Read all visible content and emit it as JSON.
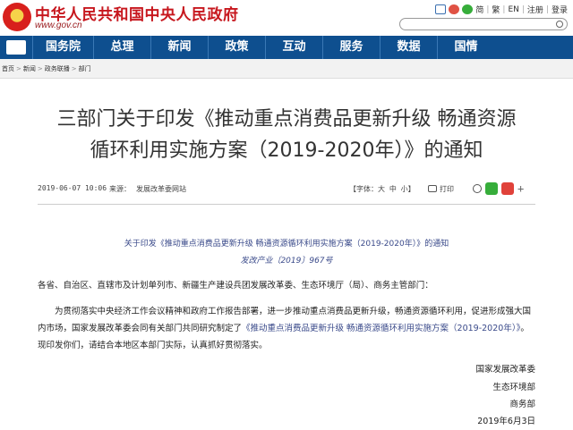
{
  "header": {
    "site_title": "中华人民共和国中央人民政府",
    "site_domain": "www.gov.cn",
    "links": [
      "简",
      "繁",
      "EN",
      "注册",
      "登录"
    ]
  },
  "nav": {
    "items": [
      "国务院",
      "总理",
      "新闻",
      "政策",
      "互动",
      "服务",
      "数据",
      "国情"
    ]
  },
  "breadcrumb": {
    "items": [
      "首页",
      "新闻",
      "政务联播",
      "部门"
    ]
  },
  "article": {
    "title_line1": "三部门关于印发《推动重点消费品更新升级 畅通资源",
    "title_line2": "循环利用实施方案（2019-2020年）》的通知",
    "date": "2019-06-07 10:06",
    "source_label": "来源：",
    "source": "发展改革委网站",
    "font_label": "【字体：大 中 小】",
    "print_label": "打印",
    "doc_heading": "关于印发《推动重点消费品更新升级 畅通资源循环利用实施方案（2019-2020年）》的通知",
    "doc_number": "发改产业〔2019〕967号",
    "addressee": "各省、自治区、直辖市及计划单列市、新疆生产建设兵团发展改革委、生态环境厅（局）、商务主管部门：",
    "body_prefix": "为贯彻落实中央经济工作会议精神和政府工作报告部署，进一步推动重点消费品更新升级，畅通资源循环利用，促进形成强大国内市场，国家发展改革委会同有关部门共同研究制定了",
    "body_link": "《推动重点消费品更新升级 畅通资源循环利用实施方案（2019-2020年）》",
    "body_suffix": "。现印发你们，请结合本地区本部门实际，认真抓好贯彻落实。",
    "signatories": [
      "国家发展改革委",
      "生态环境部",
      "商务部"
    ],
    "sign_date": "2019年6月3日"
  },
  "colors": {
    "brand_red": "#c7171e",
    "nav_blue": "#0e4f8f",
    "link_blue": "#3a4a8a"
  }
}
